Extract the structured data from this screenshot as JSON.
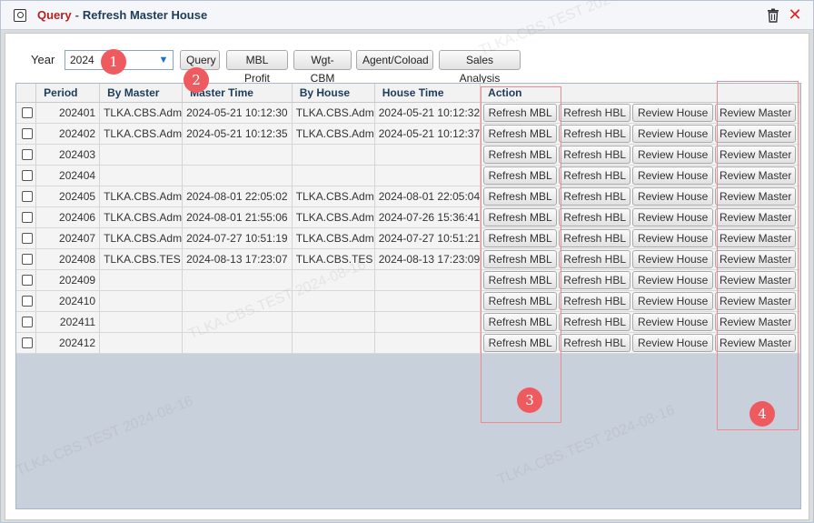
{
  "window": {
    "title_prefix": "Query",
    "title_separator": "-",
    "title_main": "Refresh Master House"
  },
  "toolbar": {
    "year_label": "Year",
    "year_value": "2024",
    "buttons": [
      "Query",
      "MBL Profit",
      "Wgt-CBM",
      "Agent/Coload",
      "Sales Analysis"
    ]
  },
  "table": {
    "columns": [
      "Period",
      "By Master",
      "Master Time",
      "By House",
      "House Time",
      "Action"
    ],
    "action_buttons": [
      "Refresh MBL",
      "Refresh HBL",
      "Review House",
      "Review Master"
    ],
    "rows": [
      {
        "period": "202401",
        "by_master": "TLKA.CBS.Adm",
        "master_time": "2024-05-21 10:12:30",
        "by_house": "TLKA.CBS.Adm",
        "house_time": "2024-05-21 10:12:32"
      },
      {
        "period": "202402",
        "by_master": "TLKA.CBS.Adm",
        "master_time": "2024-05-21 10:12:35",
        "by_house": "TLKA.CBS.Adm",
        "house_time": "2024-05-21 10:12:37"
      },
      {
        "period": "202403",
        "by_master": "",
        "master_time": "",
        "by_house": "",
        "house_time": ""
      },
      {
        "period": "202404",
        "by_master": "",
        "master_time": "",
        "by_house": "",
        "house_time": ""
      },
      {
        "period": "202405",
        "by_master": "TLKA.CBS.Adm",
        "master_time": "2024-08-01 22:05:02",
        "by_house": "TLKA.CBS.Adm",
        "house_time": "2024-08-01 22:05:04"
      },
      {
        "period": "202406",
        "by_master": "TLKA.CBS.Adm",
        "master_time": "2024-08-01 21:55:06",
        "by_house": "TLKA.CBS.Adm",
        "house_time": "2024-07-26 15:36:41"
      },
      {
        "period": "202407",
        "by_master": "TLKA.CBS.Adm",
        "master_time": "2024-07-27 10:51:19",
        "by_house": "TLKA.CBS.Adm",
        "house_time": "2024-07-27 10:51:21"
      },
      {
        "period": "202408",
        "by_master": "TLKA.CBS.TES",
        "master_time": "2024-08-13 17:23:07",
        "by_house": "TLKA.CBS.TES",
        "house_time": "2024-08-13 17:23:09"
      },
      {
        "period": "202409",
        "by_master": "",
        "master_time": "",
        "by_house": "",
        "house_time": ""
      },
      {
        "period": "202410",
        "by_master": "",
        "master_time": "",
        "by_house": "",
        "house_time": ""
      },
      {
        "period": "202411",
        "by_master": "",
        "master_time": "",
        "by_house": "",
        "house_time": ""
      },
      {
        "period": "202412",
        "by_master": "",
        "master_time": "",
        "by_house": "",
        "house_time": ""
      }
    ]
  },
  "annotations": {
    "markers": [
      "1",
      "2",
      "3",
      "4"
    ]
  },
  "watermark": {
    "text": "TLKA.CBS.TEST 2024-08-16"
  },
  "colors": {
    "title_prefix": "#b22222",
    "title_main": "#1e3c5a",
    "header_text": "#1e3c5a",
    "marker": "#ef5a5f",
    "grid_empty": "#c8d0dc",
    "close": "#dd2222"
  },
  "icons": {
    "window": "search-window-icon",
    "trash": "trash-icon",
    "close": "close-icon",
    "dropdown": "chevron-down-icon"
  }
}
